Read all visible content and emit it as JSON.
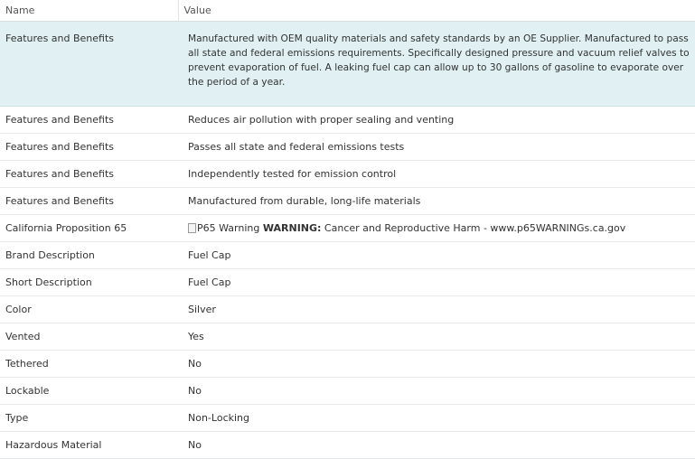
{
  "table": {
    "headers": {
      "name": "Name",
      "value": "Value"
    },
    "rows": [
      {
        "name": "Features and Benefits",
        "value": "Manufactured with OEM quality materials and safety standards by an OE Supplier. Manufactured to pass all state and federal emissions requirements. Specifically designed pressure and vacuum relief valves to prevent evaporation of fuel. A leaking fuel cap can allow up to 30 gallons of gasoline to evaporate over the period of a year."
      },
      {
        "name": "Features and Benefits",
        "value": "Reduces air pollution with proper sealing and venting"
      },
      {
        "name": "Features and Benefits",
        "value": "Passes all state and federal emissions tests"
      },
      {
        "name": "Features and Benefits",
        "value": "Independently tested for emission control"
      },
      {
        "name": "Features and Benefits",
        "value": "Manufactured from durable, long-life materials"
      },
      {
        "name": "California Proposition 65",
        "value_img_alt": "P65 Warning",
        "value_strong": "WARNING:",
        "value_rest": "Cancer and Reproductive Harm - www.p65WARNINGs.ca.gov"
      },
      {
        "name": "Brand Description",
        "value": "Fuel Cap"
      },
      {
        "name": "Short Description",
        "value": "Fuel Cap"
      },
      {
        "name": "Color",
        "value": "Silver"
      },
      {
        "name": "Vented",
        "value": "Yes"
      },
      {
        "name": "Tethered",
        "value": "No"
      },
      {
        "name": "Lockable",
        "value": "No"
      },
      {
        "name": "Type",
        "value": "Non-Locking"
      },
      {
        "name": "Hazardous Material",
        "value": "No"
      }
    ]
  }
}
